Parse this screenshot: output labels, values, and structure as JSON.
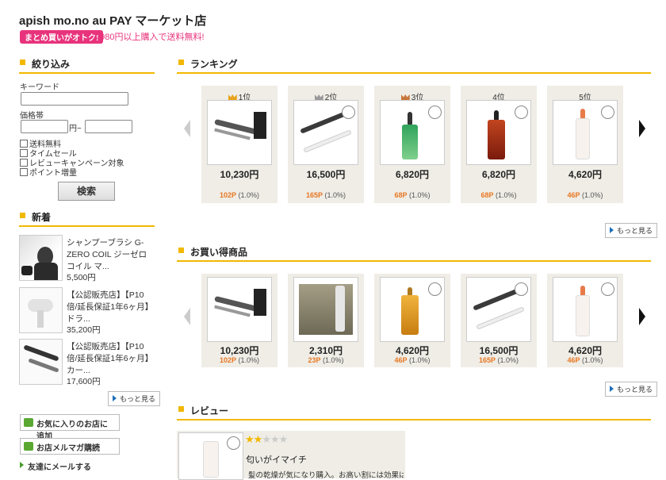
{
  "shop": {
    "title": "apish mo.no au PAY マーケット店",
    "promo_badge": "まとめ買いがオトク!",
    "promo_text": "3,980円以上購入で送料無料!"
  },
  "filter": {
    "heading": "絞り込み",
    "keyword_label": "キーワード",
    "price_label": "価格帯",
    "price_sep": "円~",
    "checkboxes": [
      "送料無料",
      "タイムセール",
      "レビューキャンペーン対象",
      "ポイント増量"
    ],
    "search_button": "検索"
  },
  "new_arrivals": {
    "heading": "新着",
    "items": [
      {
        "name": "シャンプーブラシ G-ZERO COIL ジーゼロコイル マ...",
        "price": "5,500円"
      },
      {
        "name": "【公認販売店】【P10倍/延長保証1年6ヶ月】 ドラ...",
        "price": "35,200円"
      },
      {
        "name": "【公認販売店】【P10倍/延長保証1年6ヶ月】 カー...",
        "price": "17,600円"
      }
    ],
    "more": "もっと見る"
  },
  "side_buttons": {
    "favorite": "お気に入りのお店に追加",
    "mailmag": "お店メルマガ購読",
    "friend": "友達にメールする"
  },
  "ranking": {
    "heading": "ランキング",
    "more": "もっと見る",
    "items": [
      {
        "rank": "1位",
        "price": "10,230円",
        "points": "102P",
        "rate": "(1.0%)",
        "crown": "#e8a21c"
      },
      {
        "rank": "2位",
        "price": "16,500円",
        "points": "165P",
        "rate": "(1.0%)",
        "crown": "#9a9a9a"
      },
      {
        "rank": "3位",
        "price": "6,820円",
        "points": "68P",
        "rate": "(1.0%)",
        "crown": "#c8753a"
      },
      {
        "rank": "4位",
        "price": "6,820円",
        "points": "68P",
        "rate": "(1.0%)",
        "crown": ""
      },
      {
        "rank": "5位",
        "price": "4,620円",
        "points": "46P",
        "rate": "(1.0%)",
        "crown": ""
      }
    ]
  },
  "deals": {
    "heading": "お買い得商品",
    "more": "もっと見る",
    "items": [
      {
        "price": "10,230円",
        "points": "102P",
        "rate": "(1.0%)"
      },
      {
        "price": "2,310円",
        "points": "23P",
        "rate": "(1.0%)"
      },
      {
        "price": "4,620円",
        "points": "46P",
        "rate": "(1.0%)"
      },
      {
        "price": "16,500円",
        "points": "165P",
        "rate": "(1.0%)"
      },
      {
        "price": "4,620円",
        "points": "46P",
        "rate": "(1.0%)"
      }
    ]
  },
  "review": {
    "heading": "レビュー",
    "stars": 2,
    "title": "匂いがイマイチ",
    "body": "髪の乾燥が気になり購入。お高い割には効果はよ"
  },
  "colors": {
    "accent": "#f2b800",
    "points": "#e87722",
    "promo": "#e8337c"
  }
}
